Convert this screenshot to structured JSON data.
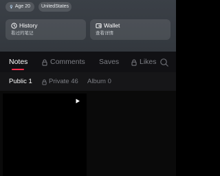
{
  "profile": {
    "age_badge": "Age 20",
    "location_badge": "UnitedStates"
  },
  "cards": {
    "history": {
      "title": "History",
      "subtitle": "看过的笔记",
      "icon": "clock-icon"
    },
    "wallet": {
      "title": "Wallet",
      "subtitle": "查看详情",
      "icon": "wallet-icon"
    }
  },
  "tabs": [
    {
      "label": "Notes",
      "active": true
    },
    {
      "label": "Comments",
      "locked": true
    },
    {
      "label": "Saves"
    },
    {
      "label": "Likes",
      "locked": true
    }
  ],
  "subtabs": [
    {
      "label": "Public 1",
      "active": true
    },
    {
      "label": "Private 46",
      "locked": true
    },
    {
      "label": "Album 0"
    }
  ],
  "colors": {
    "accent": "#ff2e4d",
    "header_bg": "#383d43",
    "page_bg": "#000000",
    "inactive_text": "#7d7f85"
  }
}
